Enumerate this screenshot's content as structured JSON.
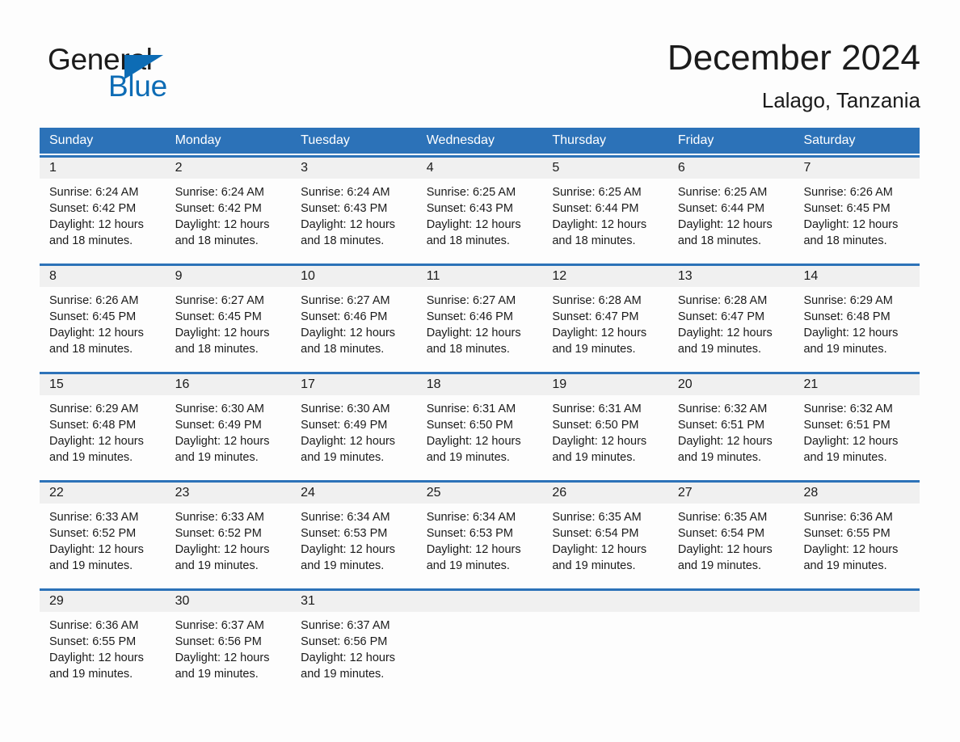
{
  "brand": {
    "name_part1": "General",
    "name_part2": "Blue",
    "accent_color": "#0d6cb5",
    "triangle_icon": "brand-triangle-icon"
  },
  "header": {
    "title": "December 2024",
    "location": "Lalago, Tanzania"
  },
  "theme": {
    "header_bar_color": "#2c72b8",
    "day_band_color": "#f0f0f0",
    "row_divider_color": "#2c72b8",
    "text_color": "#1b1b1b",
    "page_background": "#fdfdfd"
  },
  "weekdays": [
    "Sunday",
    "Monday",
    "Tuesday",
    "Wednesday",
    "Thursday",
    "Friday",
    "Saturday"
  ],
  "weeks": [
    [
      {
        "day": "1",
        "sunrise": "Sunrise: 6:24 AM",
        "sunset": "Sunset: 6:42 PM",
        "daylight": "Daylight: 12 hours and 18 minutes."
      },
      {
        "day": "2",
        "sunrise": "Sunrise: 6:24 AM",
        "sunset": "Sunset: 6:42 PM",
        "daylight": "Daylight: 12 hours and 18 minutes."
      },
      {
        "day": "3",
        "sunrise": "Sunrise: 6:24 AM",
        "sunset": "Sunset: 6:43 PM",
        "daylight": "Daylight: 12 hours and 18 minutes."
      },
      {
        "day": "4",
        "sunrise": "Sunrise: 6:25 AM",
        "sunset": "Sunset: 6:43 PM",
        "daylight": "Daylight: 12 hours and 18 minutes."
      },
      {
        "day": "5",
        "sunrise": "Sunrise: 6:25 AM",
        "sunset": "Sunset: 6:44 PM",
        "daylight": "Daylight: 12 hours and 18 minutes."
      },
      {
        "day": "6",
        "sunrise": "Sunrise: 6:25 AM",
        "sunset": "Sunset: 6:44 PM",
        "daylight": "Daylight: 12 hours and 18 minutes."
      },
      {
        "day": "7",
        "sunrise": "Sunrise: 6:26 AM",
        "sunset": "Sunset: 6:45 PM",
        "daylight": "Daylight: 12 hours and 18 minutes."
      }
    ],
    [
      {
        "day": "8",
        "sunrise": "Sunrise: 6:26 AM",
        "sunset": "Sunset: 6:45 PM",
        "daylight": "Daylight: 12 hours and 18 minutes."
      },
      {
        "day": "9",
        "sunrise": "Sunrise: 6:27 AM",
        "sunset": "Sunset: 6:45 PM",
        "daylight": "Daylight: 12 hours and 18 minutes."
      },
      {
        "day": "10",
        "sunrise": "Sunrise: 6:27 AM",
        "sunset": "Sunset: 6:46 PM",
        "daylight": "Daylight: 12 hours and 18 minutes."
      },
      {
        "day": "11",
        "sunrise": "Sunrise: 6:27 AM",
        "sunset": "Sunset: 6:46 PM",
        "daylight": "Daylight: 12 hours and 18 minutes."
      },
      {
        "day": "12",
        "sunrise": "Sunrise: 6:28 AM",
        "sunset": "Sunset: 6:47 PM",
        "daylight": "Daylight: 12 hours and 19 minutes."
      },
      {
        "day": "13",
        "sunrise": "Sunrise: 6:28 AM",
        "sunset": "Sunset: 6:47 PM",
        "daylight": "Daylight: 12 hours and 19 minutes."
      },
      {
        "day": "14",
        "sunrise": "Sunrise: 6:29 AM",
        "sunset": "Sunset: 6:48 PM",
        "daylight": "Daylight: 12 hours and 19 minutes."
      }
    ],
    [
      {
        "day": "15",
        "sunrise": "Sunrise: 6:29 AM",
        "sunset": "Sunset: 6:48 PM",
        "daylight": "Daylight: 12 hours and 19 minutes."
      },
      {
        "day": "16",
        "sunrise": "Sunrise: 6:30 AM",
        "sunset": "Sunset: 6:49 PM",
        "daylight": "Daylight: 12 hours and 19 minutes."
      },
      {
        "day": "17",
        "sunrise": "Sunrise: 6:30 AM",
        "sunset": "Sunset: 6:49 PM",
        "daylight": "Daylight: 12 hours and 19 minutes."
      },
      {
        "day": "18",
        "sunrise": "Sunrise: 6:31 AM",
        "sunset": "Sunset: 6:50 PM",
        "daylight": "Daylight: 12 hours and 19 minutes."
      },
      {
        "day": "19",
        "sunrise": "Sunrise: 6:31 AM",
        "sunset": "Sunset: 6:50 PM",
        "daylight": "Daylight: 12 hours and 19 minutes."
      },
      {
        "day": "20",
        "sunrise": "Sunrise: 6:32 AM",
        "sunset": "Sunset: 6:51 PM",
        "daylight": "Daylight: 12 hours and 19 minutes."
      },
      {
        "day": "21",
        "sunrise": "Sunrise: 6:32 AM",
        "sunset": "Sunset: 6:51 PM",
        "daylight": "Daylight: 12 hours and 19 minutes."
      }
    ],
    [
      {
        "day": "22",
        "sunrise": "Sunrise: 6:33 AM",
        "sunset": "Sunset: 6:52 PM",
        "daylight": "Daylight: 12 hours and 19 minutes."
      },
      {
        "day": "23",
        "sunrise": "Sunrise: 6:33 AM",
        "sunset": "Sunset: 6:52 PM",
        "daylight": "Daylight: 12 hours and 19 minutes."
      },
      {
        "day": "24",
        "sunrise": "Sunrise: 6:34 AM",
        "sunset": "Sunset: 6:53 PM",
        "daylight": "Daylight: 12 hours and 19 minutes."
      },
      {
        "day": "25",
        "sunrise": "Sunrise: 6:34 AM",
        "sunset": "Sunset: 6:53 PM",
        "daylight": "Daylight: 12 hours and 19 minutes."
      },
      {
        "day": "26",
        "sunrise": "Sunrise: 6:35 AM",
        "sunset": "Sunset: 6:54 PM",
        "daylight": "Daylight: 12 hours and 19 minutes."
      },
      {
        "day": "27",
        "sunrise": "Sunrise: 6:35 AM",
        "sunset": "Sunset: 6:54 PM",
        "daylight": "Daylight: 12 hours and 19 minutes."
      },
      {
        "day": "28",
        "sunrise": "Sunrise: 6:36 AM",
        "sunset": "Sunset: 6:55 PM",
        "daylight": "Daylight: 12 hours and 19 minutes."
      }
    ],
    [
      {
        "day": "29",
        "sunrise": "Sunrise: 6:36 AM",
        "sunset": "Sunset: 6:55 PM",
        "daylight": "Daylight: 12 hours and 19 minutes."
      },
      {
        "day": "30",
        "sunrise": "Sunrise: 6:37 AM",
        "sunset": "Sunset: 6:56 PM",
        "daylight": "Daylight: 12 hours and 19 minutes."
      },
      {
        "day": "31",
        "sunrise": "Sunrise: 6:37 AM",
        "sunset": "Sunset: 6:56 PM",
        "daylight": "Daylight: 12 hours and 19 minutes."
      },
      {
        "day": "",
        "sunrise": "",
        "sunset": "",
        "daylight": ""
      },
      {
        "day": "",
        "sunrise": "",
        "sunset": "",
        "daylight": ""
      },
      {
        "day": "",
        "sunrise": "",
        "sunset": "",
        "daylight": ""
      },
      {
        "day": "",
        "sunrise": "",
        "sunset": "",
        "daylight": ""
      }
    ]
  ]
}
